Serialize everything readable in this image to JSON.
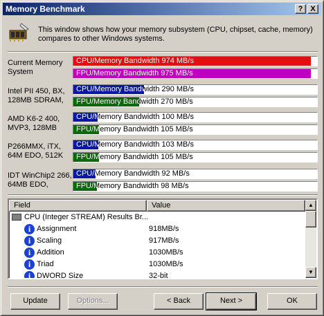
{
  "window": {
    "title": "Memory Benchmark",
    "help_label": "?",
    "close_label": "X"
  },
  "intro": {
    "icon": "memory-chip-icon",
    "text": "This window shows how your memory subsystem (CPU, chipset, cache, memory) compares to other Windows systems."
  },
  "benchmarks": [
    {
      "label": "Current Memory System",
      "cpu": {
        "text": "CPU/Memory Bandwidth 974 MB/s",
        "value": 974,
        "color": "#e01010"
      },
      "fpu": {
        "text": "FPU/Memory Bandwidth 975 MB/s",
        "value": 975,
        "color": "#c000c0"
      }
    },
    {
      "label": "Intel PII 450, BX, 128MB SDRAM,",
      "cpu": {
        "text": "CPU/Memory Bandwidth 290 MB/s",
        "value": 290,
        "color": "#0a1aa0"
      },
      "fpu": {
        "text": "FPU/Memory Bandwidth 270 MB/s",
        "value": 270,
        "color": "#0a6a0a"
      }
    },
    {
      "label": "AMD K6-2 400, MVP3, 128MB",
      "cpu": {
        "text": "CPU/Memory Bandwidth 100 MB/s",
        "value": 100,
        "color": "#0a1aa0"
      },
      "fpu": {
        "text": "FPU/Memory Bandwidth 105 MB/s",
        "value": 105,
        "color": "#0a6a0a"
      }
    },
    {
      "label": "P266MMX, iTX, 64M EDO, 512K",
      "cpu": {
        "text": "CPU/Memory Bandwidth 103 MB/s",
        "value": 103,
        "color": "#0a1aa0"
      },
      "fpu": {
        "text": "FPU/Memory Bandwidth 105 MB/s",
        "value": 105,
        "color": "#0a6a0a"
      }
    },
    {
      "label": "IDT WinChip2 266, 64MB EDO,",
      "cpu": {
        "text": "CPU/Memory Bandwidth 92 MB/s",
        "value": 92,
        "color": "#0a1aa0"
      },
      "fpu": {
        "text": "FPU/Memory Bandwidth 98 MB/s",
        "value": 98,
        "color": "#0a6a0a"
      }
    }
  ],
  "bar_scale_max": 1000,
  "results": {
    "columns": [
      "Field",
      "Value"
    ],
    "group": "CPU (Integer STREAM) Results Br...",
    "rows": [
      {
        "field": "Assignment",
        "value": "918MB/s"
      },
      {
        "field": "Scaling",
        "value": "917MB/s"
      },
      {
        "field": "Addition",
        "value": "1030MB/s"
      },
      {
        "field": "Triad",
        "value": "1030MB/s"
      },
      {
        "field": "DWORD Size",
        "value": "32-bit"
      }
    ]
  },
  "buttons": {
    "update": "Update",
    "options": "Options...",
    "back": "< Back",
    "next": "Next >",
    "ok": "OK"
  }
}
